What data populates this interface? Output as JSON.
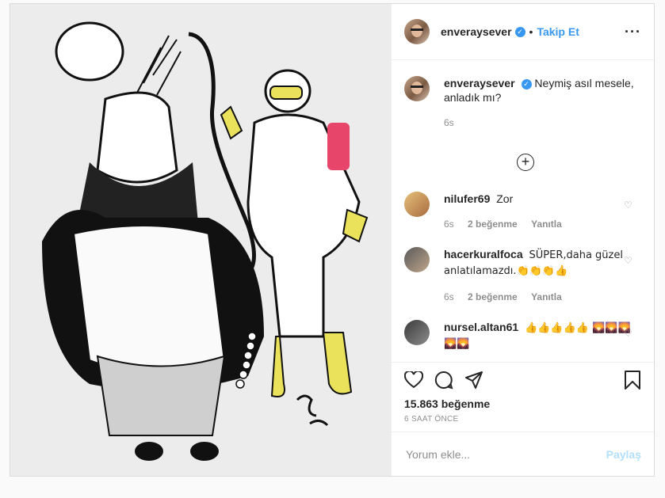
{
  "post": {
    "username": "enveraysever",
    "follow_label": "Takip Et",
    "more_icon": "more-options-icon"
  },
  "caption": {
    "username": "enveraysever",
    "text": "Neymiş asıl mesele, anladık mı?",
    "age": "6s"
  },
  "comments": [
    {
      "username": "nilufer69",
      "text": "Zor",
      "age": "6s",
      "likes": "2 beğenme",
      "reply": "Yanıtla"
    },
    {
      "username": "hacerkuralfoca",
      "text": "SÜPER,daha güzel anlatılamazdı.👏👏👏👍",
      "age": "6s",
      "likes": "2 beğenme",
      "reply": "Yanıtla"
    },
    {
      "username": "nursel.altan61",
      "text": "👍👍👍👍👍 🌄🌄🌄🌄🌄",
      "age": "",
      "likes": "",
      "reply": ""
    }
  ],
  "stats": {
    "likes": "15.863 beğenme",
    "time_ago": "6 SAAT ÖNCE"
  },
  "add_comment": {
    "placeholder": "Yorum ekle...",
    "share_label": "Paylaş"
  },
  "icons": [
    "heart-icon",
    "comment-icon",
    "share-icon",
    "save-icon",
    "add-icon"
  ]
}
